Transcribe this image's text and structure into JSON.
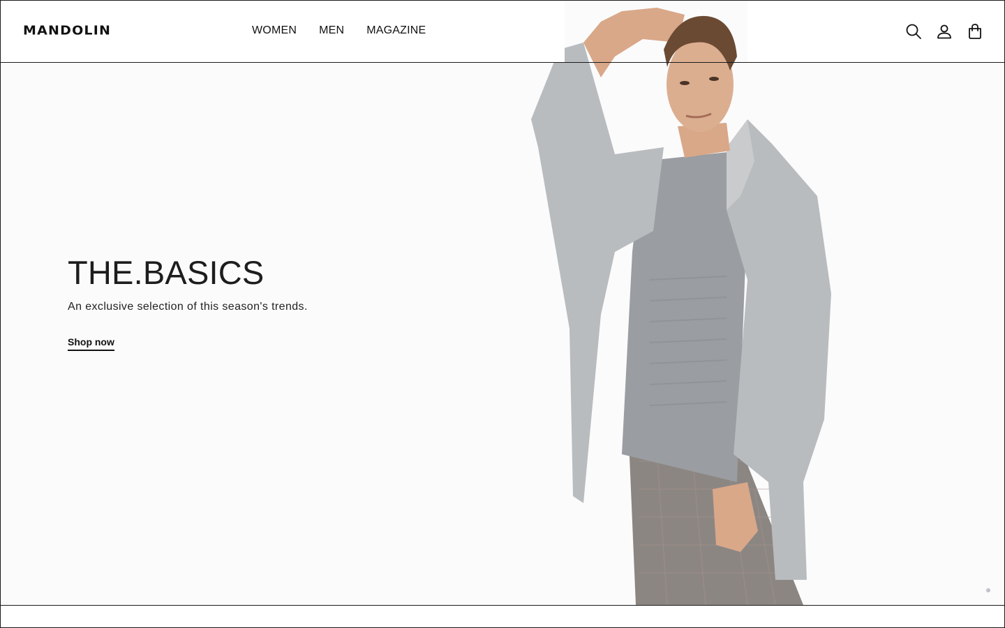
{
  "brand": {
    "logo": "MANDOLIN"
  },
  "nav": [
    {
      "label": "WOMEN"
    },
    {
      "label": "MEN"
    },
    {
      "label": "MAGAZINE"
    }
  ],
  "header_icons": [
    "search-icon",
    "account-icon",
    "shopping-bag-icon"
  ],
  "hero": {
    "title": "THE.BASICS",
    "subtitle": "An exclusive selection of this season's trends.",
    "cta": "Shop now",
    "slides_total": 1,
    "active_slide": 1
  },
  "colors": {
    "text": "#111111",
    "hero_background": "#fbfbfc",
    "coat": "#b9bcbe",
    "sweater": "#9a9da1",
    "skin": "#d9a889",
    "hair": "#6b4a33",
    "trousers": "#8c8683"
  }
}
